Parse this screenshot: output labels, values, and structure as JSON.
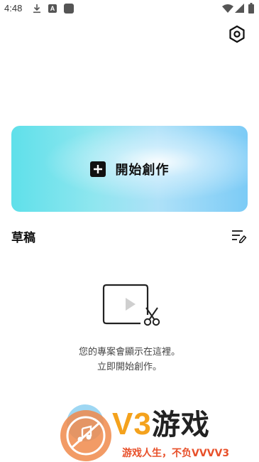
{
  "status_bar": {
    "time": "4:48",
    "letter_icon": "A"
  },
  "create": {
    "label": "開始創作"
  },
  "drafts": {
    "title": "草稿",
    "empty_line1": "您的專案會顯示在這裡。",
    "empty_line2": "立即開始創作。"
  },
  "watermark": {
    "brand_latin": "V3",
    "brand_cn": "游戏",
    "slogan": "游戏人生，不负VVVV3"
  },
  "colors": {
    "card_start": "#5fe0ea",
    "card_end": "#7ccbf6",
    "watermark_orange": "#f4a21d",
    "watermark_red": "#e8502a"
  },
  "icons": [
    "download-icon",
    "text-a-icon",
    "app-square-icon",
    "wifi-icon",
    "signal-icon",
    "battery-icon",
    "settings-hexagon-icon",
    "plus-icon",
    "edit-list-icon",
    "video-scissors-icon"
  ]
}
